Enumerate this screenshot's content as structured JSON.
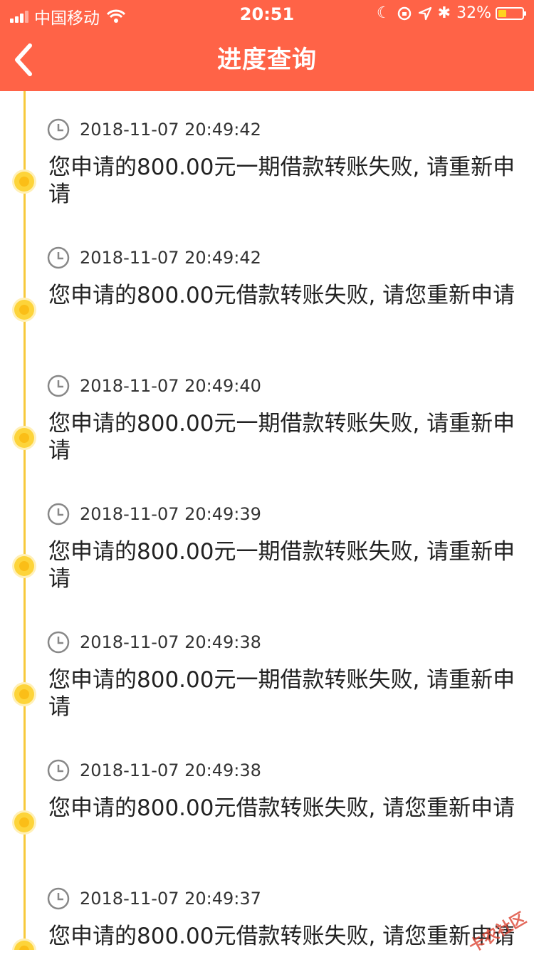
{
  "status_bar": {
    "carrier": "中国移动",
    "time": "20:51",
    "battery_percent": "32%",
    "battery_level": 0.32
  },
  "nav": {
    "title": "进度查询",
    "back_icon": "chevron-left-icon"
  },
  "colors": {
    "header": "#ff6347",
    "timeline": "#f7c93c",
    "dot": "#fbbe17"
  },
  "entries": [
    {
      "time": "2018-11-07 20:49:42",
      "message": "您申请的800.00元一期借款转账失败, 请重新申请"
    },
    {
      "time": "2018-11-07 20:49:42",
      "message": "您申请的800.00元借款转账失败, 请您重新申请"
    },
    {
      "time": "2018-11-07 20:49:40",
      "message": "您申请的800.00元一期借款转账失败, 请重新申请"
    },
    {
      "time": "2018-11-07 20:49:39",
      "message": "您申请的800.00元一期借款转账失败, 请重新申请"
    },
    {
      "time": "2018-11-07 20:49:38",
      "message": "您申请的800.00元一期借款转账失败, 请重新申请"
    },
    {
      "time": "2018-11-07 20:49:38",
      "message": "您申请的800.00元借款转账失败, 请您重新申请"
    },
    {
      "time": "2018-11-07 20:49:37",
      "message": "您申请的800.00元借款转账失败, 请您重新申请"
    }
  ],
  "watermark": "卡农社区"
}
